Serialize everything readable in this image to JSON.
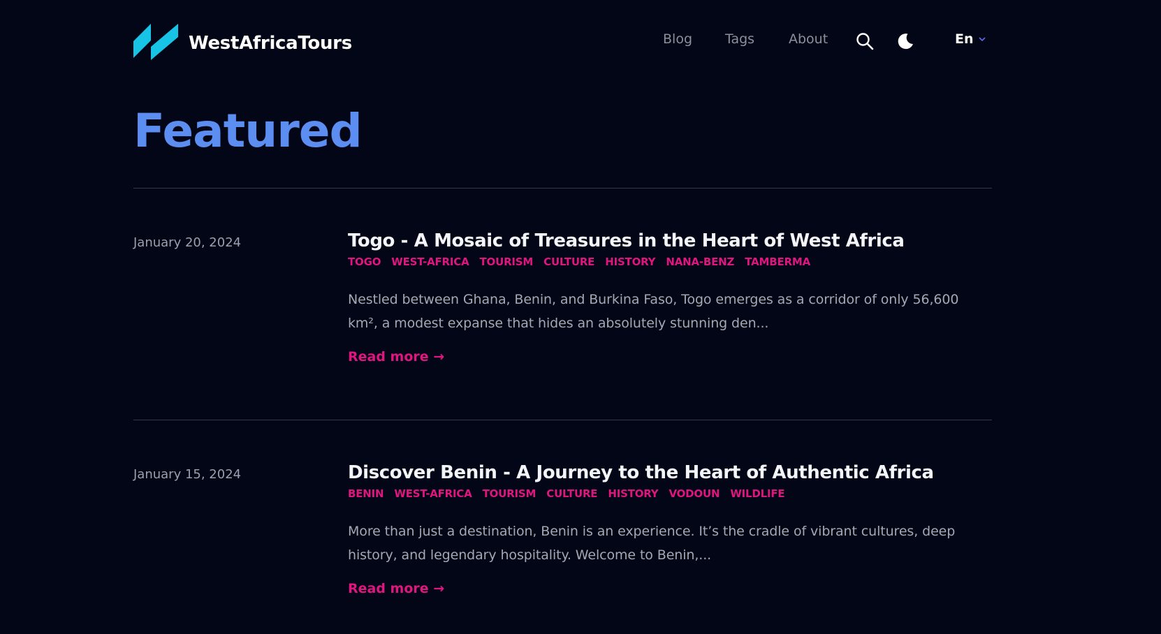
{
  "header": {
    "brand": "WestAfricaTours",
    "nav": {
      "blog": "Blog",
      "tags": "Tags",
      "about": "About",
      "language": "En"
    },
    "icons": {
      "logo": "logo-mark-icon",
      "search": "search-icon",
      "theme": "moon-icon",
      "language_dropdown": "chevron-down-icon"
    }
  },
  "main": {
    "heading": "Featured",
    "posts": [
      {
        "date": "January 20, 2024",
        "title": "Togo - A Mosaic of Treasures in the Heart of West Africa",
        "tags": [
          "TOGO",
          "WEST-AFRICA",
          "TOURISM",
          "CULTURE",
          "HISTORY",
          "NANA-BENZ",
          "TAMBERMA"
        ],
        "excerpt": "Nestled between Ghana, Benin, and Burkina Faso, Togo emerges as a corridor of only 56,600 km², a modest expanse that hides an absolutely stunning den...",
        "read_more": "Read more →"
      },
      {
        "date": "January 15, 2024",
        "title": "Discover Benin - A Journey to the Heart of Authentic Africa",
        "tags": [
          "BENIN",
          "WEST-AFRICA",
          "TOURISM",
          "CULTURE",
          "HISTORY",
          "VODOUN",
          "WILDLIFE"
        ],
        "excerpt": "More than just a destination, Benin is an experience. It’s the cradle of vibrant cultures, deep history, and legendary hospitality. Welcome to Benin,...",
        "read_more": "Read more →"
      }
    ]
  },
  "colors": {
    "background": "#030616",
    "heading_accent": "#5b8ef0",
    "tag_and_link": "#e0157f",
    "logo_cyan": "#16c7e8",
    "nav_muted": "#8b909c"
  }
}
